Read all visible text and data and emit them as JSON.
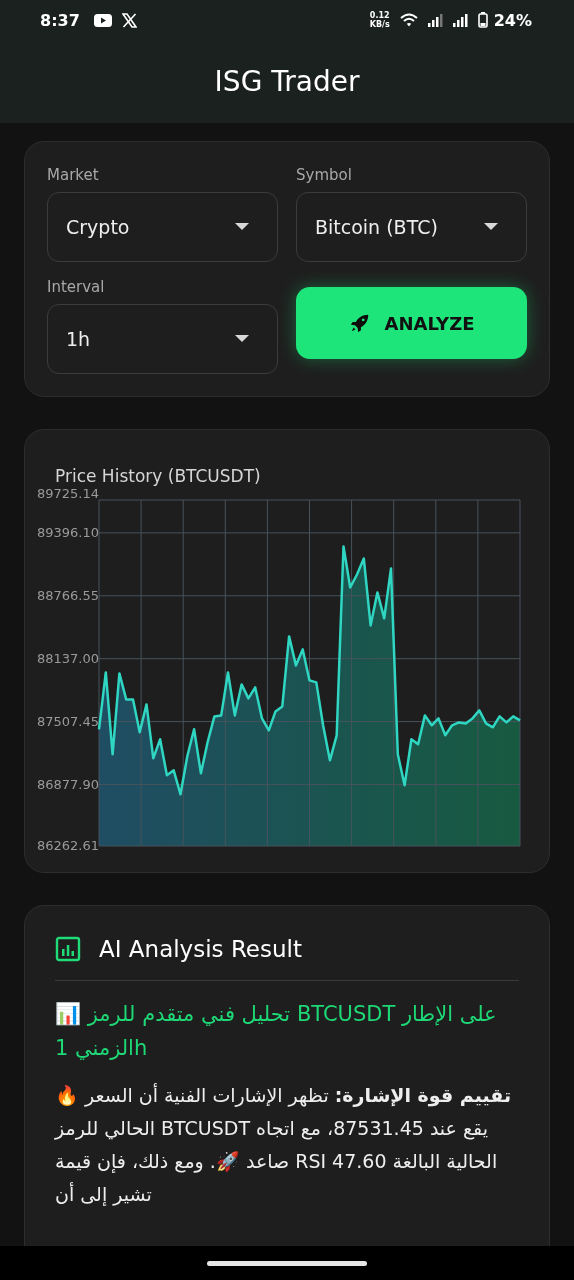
{
  "status_bar": {
    "time": "8:37",
    "net_speed_value": "0.12",
    "net_speed_unit": "KB/s",
    "battery": "24%"
  },
  "header": {
    "title": "ISG Trader"
  },
  "form": {
    "fields": [
      {
        "label": "Market",
        "value": "Crypto"
      },
      {
        "label": "Symbol",
        "value": "Bitcoin (BTC)"
      },
      {
        "label": "Interval",
        "value": "1h"
      }
    ],
    "analyze_button": "ANALYZE"
  },
  "price_history": {
    "title": "Price History (BTCUSDT)",
    "chart_data": {
      "type": "area",
      "ylim": [
        86262.61,
        89725.14
      ],
      "yticks": [
        {
          "value": 89725.14,
          "label": "89725.14"
        },
        {
          "value": 89396.1,
          "label": "89396.10"
        },
        {
          "value": 88766.55,
          "label": "88766.55"
        },
        {
          "value": 88137.0,
          "label": "88137.00"
        },
        {
          "value": 87507.45,
          "label": "87507.45"
        },
        {
          "value": 86877.9,
          "label": "86877.90"
        },
        {
          "value": 86262.61,
          "label": "86262.61"
        }
      ],
      "grid": true,
      "series": [
        {
          "color": "#2fd6c2",
          "values": [
            87430,
            88000,
            87180,
            87990,
            87730,
            87730,
            87400,
            87680,
            87140,
            87330,
            86970,
            87020,
            86780,
            87160,
            87430,
            86990,
            87300,
            87560,
            87570,
            88000,
            87570,
            87880,
            87740,
            87850,
            87540,
            87420,
            87610,
            87660,
            88360,
            88070,
            88230,
            87920,
            87900,
            87470,
            87120,
            87370,
            89260,
            88850,
            88980,
            89140,
            88470,
            88800,
            88540,
            89040,
            87180,
            86870,
            87330,
            87280,
            87570,
            87470,
            87540,
            87370,
            87470,
            87500,
            87490,
            87540,
            87620,
            87490,
            87450,
            87560,
            87500,
            87560,
            87520
          ]
        }
      ]
    }
  },
  "analysis": {
    "title": "AI Analysis Result",
    "heading": "📊 تحليل فني متقدم للرمز BTCUSDT على الإطار الزمني 1h",
    "paragraphs": [
      "🔥 **تقييم قوة الإشارة:** تظهر الإشارات الفنية أن السعر الحالي للرمز BTCUSDT يقع عند 87531.45، مع اتجاه صاعد 🚀. ومع ذلك، فإن قيمة RSI الحالية البالغة 47.60 تشير إلى أن"
    ]
  }
}
